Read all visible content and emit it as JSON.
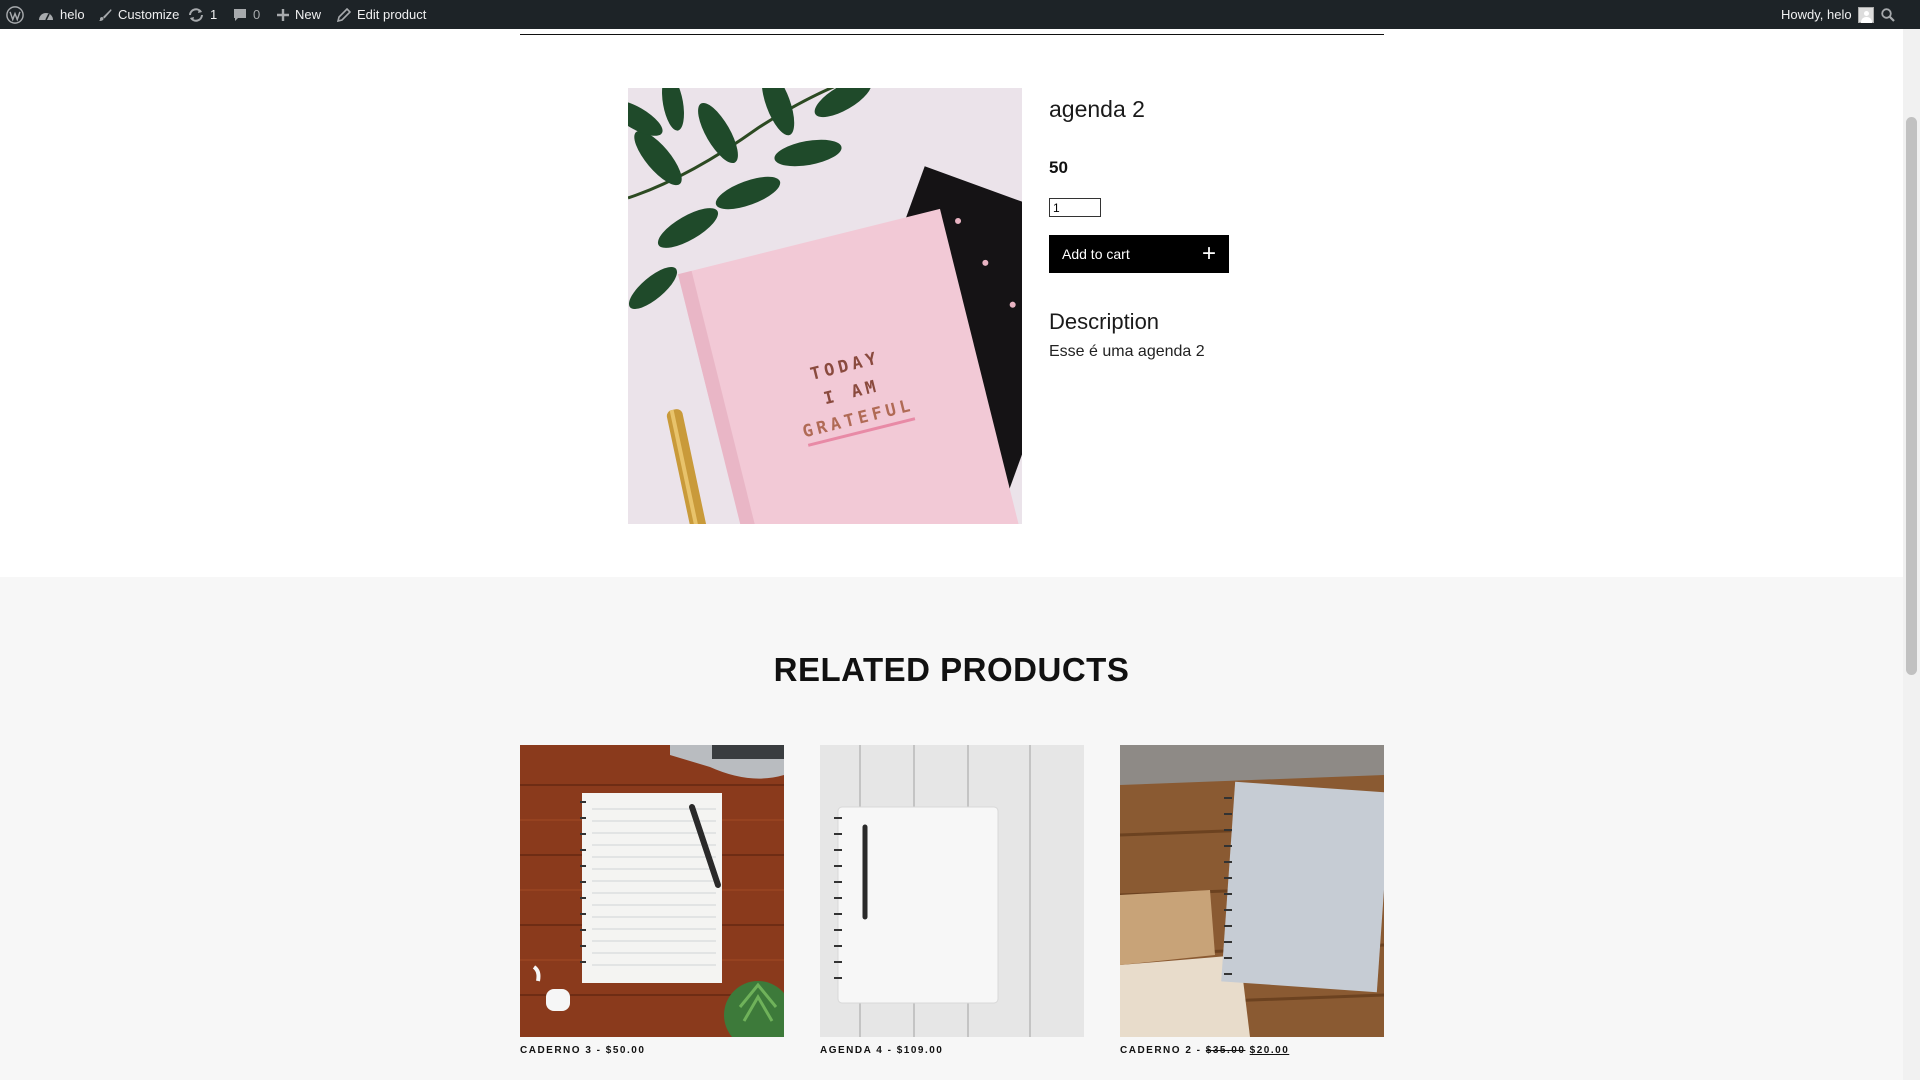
{
  "adminbar": {
    "site_name": "helo",
    "customize": "Customize",
    "updates_count": "1",
    "comments_count": "0",
    "new_label": "New",
    "edit_label": "Edit product",
    "howdy": "Howdy, helo"
  },
  "product": {
    "title": "agenda 2",
    "price": "50",
    "quantity": "1",
    "add_to_cart": "Add to cart",
    "add_icon": "+",
    "description_title": "Description",
    "description_text": "Esse é uma agenda 2",
    "image_text": [
      "TODAY",
      "I AM",
      "GRATEFUL"
    ]
  },
  "related": {
    "title": "RELATED PRODUCTS",
    "items": [
      {
        "name": "CADERNO 3",
        "separator": " - ",
        "price": "$50.00"
      },
      {
        "name": "AGENDA 4",
        "separator": " - ",
        "price": "$109.00"
      },
      {
        "name": "CADERNO 2",
        "separator": " - ",
        "old_price": "$35.00",
        "sale_price": "$20.00"
      }
    ]
  },
  "colors": {
    "adminbar_bg": "#1d2327",
    "button_bg": "#000000",
    "related_bg": "#f7f7f7"
  }
}
